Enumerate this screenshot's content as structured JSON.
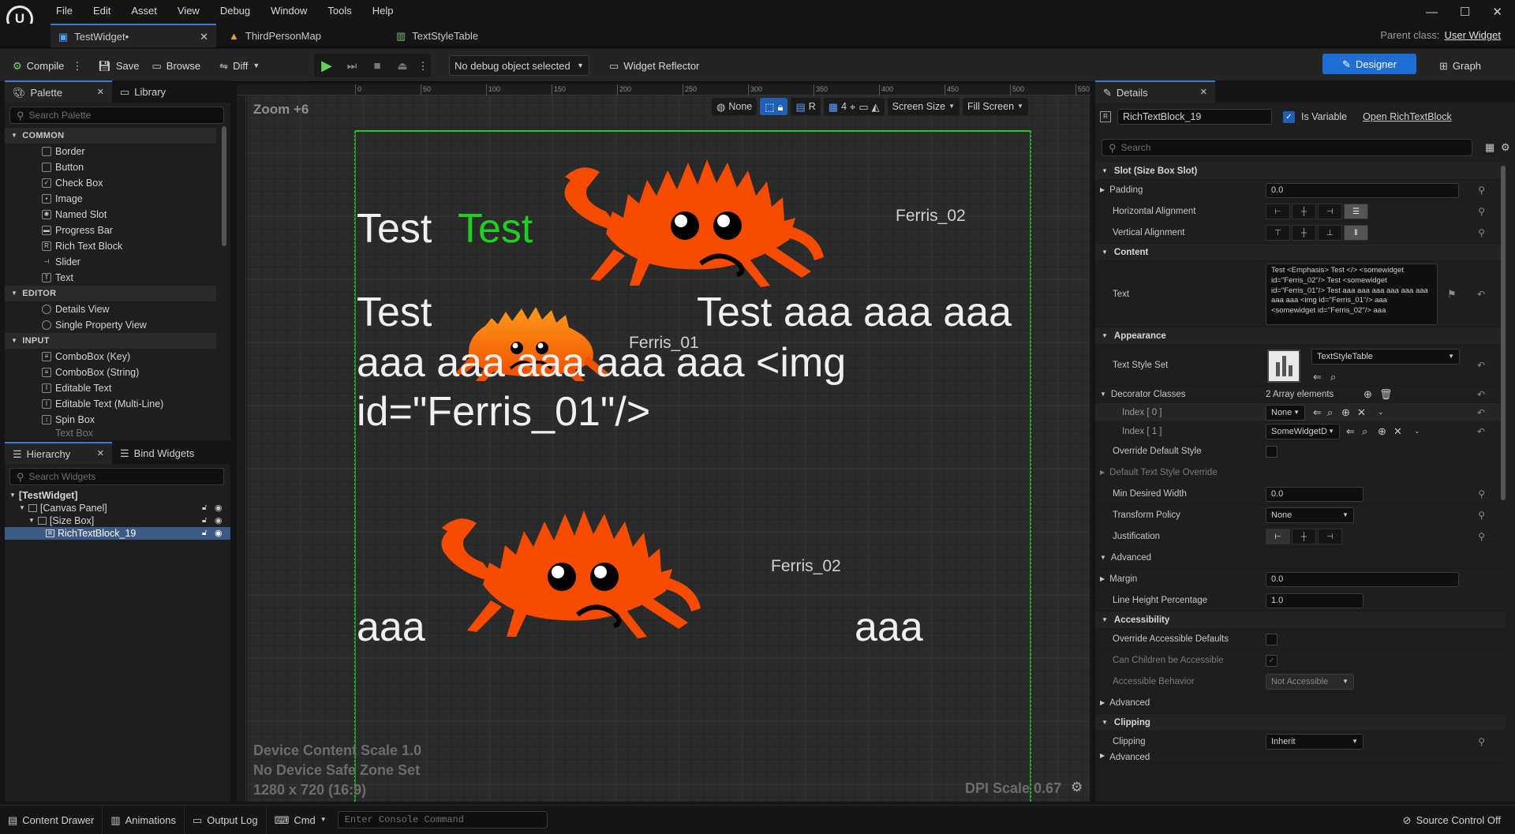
{
  "menu": [
    "File",
    "Edit",
    "Asset",
    "View",
    "Debug",
    "Window",
    "Tools",
    "Help"
  ],
  "tabs": [
    {
      "label": "TestWidget•"
    },
    {
      "label": "ThirdPersonMap"
    },
    {
      "label": "TextStyleTable"
    }
  ],
  "parent_class_label": "Parent class:",
  "parent_class_value": "User Widget",
  "toolbar": {
    "compile": "Compile",
    "save": "Save",
    "browse": "Browse",
    "diff": "Diff",
    "debug_object": "No debug object selected",
    "widget_reflector": "Widget Reflector",
    "designer": "Designer",
    "graph": "Graph"
  },
  "palette": {
    "tab": "Palette",
    "library_tab": "Library",
    "search_placeholder": "Search Palette",
    "categories": [
      {
        "name": "COMMON",
        "items": [
          "Border",
          "Button",
          "Check Box",
          "Image",
          "Named Slot",
          "Progress Bar",
          "Rich Text Block",
          "Slider",
          "Text"
        ]
      },
      {
        "name": "EDITOR",
        "items": [
          "Details View",
          "Single Property View"
        ]
      },
      {
        "name": "INPUT",
        "items": [
          "ComboBox (Key)",
          "ComboBox (String)",
          "Editable Text",
          "Editable Text (Multi-Line)",
          "Spin Box",
          "Text Box"
        ]
      }
    ]
  },
  "hierarchy": {
    "tab": "Hierarchy",
    "bind_tab": "Bind Widgets",
    "search_placeholder": "Search Widgets",
    "root": "[TestWidget]",
    "canvas_panel": "[Canvas Panel]",
    "size_box": "[Size Box]",
    "rich_text": "RichTextBlock_19"
  },
  "viewport": {
    "zoom": "Zoom +6",
    "none": "None",
    "r": "R",
    "grid": "4",
    "screen_size": "Screen Size",
    "fill_screen": "Fill Screen",
    "ruler_ticks": [
      "0",
      "50",
      "100",
      "150",
      "200",
      "250",
      "300",
      "350",
      "400",
      "450",
      "500",
      "550"
    ],
    "info1": "Device Content Scale 1.0",
    "info2": "No Device Safe Zone Set",
    "info3": "1280 x 720 (16:9)",
    "dpi": "DPI Scale 0.67",
    "text": {
      "test1": "Test",
      "test_green": "Test",
      "test2": "Test",
      "test_aaa": "Test aaa aaa aaa",
      "line3": "aaa aaa aaa aaa aaa <img",
      "line4": "id=\"Ferris_01\"/>",
      "aaa_left": "aaa",
      "aaa_right": "aaa"
    },
    "crab_labels": [
      "Ferris_02",
      "Ferris_01",
      "Ferris_02"
    ],
    "colors": {
      "crab": "#f74c00",
      "green": "#1fd11f",
      "guide": "#22cc22"
    }
  },
  "details": {
    "tab": "Details",
    "name": "RichTextBlock_19",
    "is_variable": "Is Variable",
    "open_link": "Open RichTextBlock",
    "search_placeholder": "Search",
    "slot_section": "Slot (Size Box Slot)",
    "padding_label": "Padding",
    "padding_value": "0.0",
    "halign": "Horizontal Alignment",
    "valign": "Vertical Alignment",
    "content_section": "Content",
    "text_label": "Text",
    "text_value": "Test <Emphasis> Test </> <somewidget id=\"Ferris_02\"/> Test <somewidget id=\"Ferris_01\"/> Test aaa aaa aaa aaa aaa aaa aaa aaa <img id=\"Ferris_01\"/> aaa <somewidget id=\"Ferris_02\"/> aaa",
    "appearance_section": "Appearance",
    "text_style_set": "Text Style Set",
    "text_style_value": "TextStyleTable",
    "decorator_classes": "Decorator Classes",
    "array_elements": "2 Array elements",
    "index0": "Index [ 0 ]",
    "index0_value": "None",
    "index1": "Index [ 1 ]",
    "index1_value": "SomeWidgetD",
    "override_default_style": "Override Default Style",
    "default_text_style_override": "Default Text Style Override",
    "min_desired_width": "Min Desired Width",
    "min_desired_width_value": "0.0",
    "transform_policy": "Transform Policy",
    "transform_policy_value": "None",
    "justification": "Justification",
    "advanced": "Advanced",
    "margin": "Margin",
    "margin_value": "0.0",
    "line_height": "Line Height Percentage",
    "line_height_value": "1.0",
    "accessibility_section": "Accessibility",
    "override_accessible": "Override Accessible Defaults",
    "can_children": "Can Children be Accessible",
    "accessible_behavior": "Accessible Behavior",
    "accessible_behavior_value": "Not Accessible",
    "advanced2": "Advanced",
    "clipping_section": "Clipping",
    "clipping_label": "Clipping",
    "clipping_value": "Inherit",
    "advanced3": "Advanced"
  },
  "statusbar": {
    "content_drawer": "Content Drawer",
    "animations": "Animations",
    "output_log": "Output Log",
    "cmd": "Cmd",
    "console_placeholder": "Enter Console Command",
    "source_control": "Source Control Off"
  }
}
